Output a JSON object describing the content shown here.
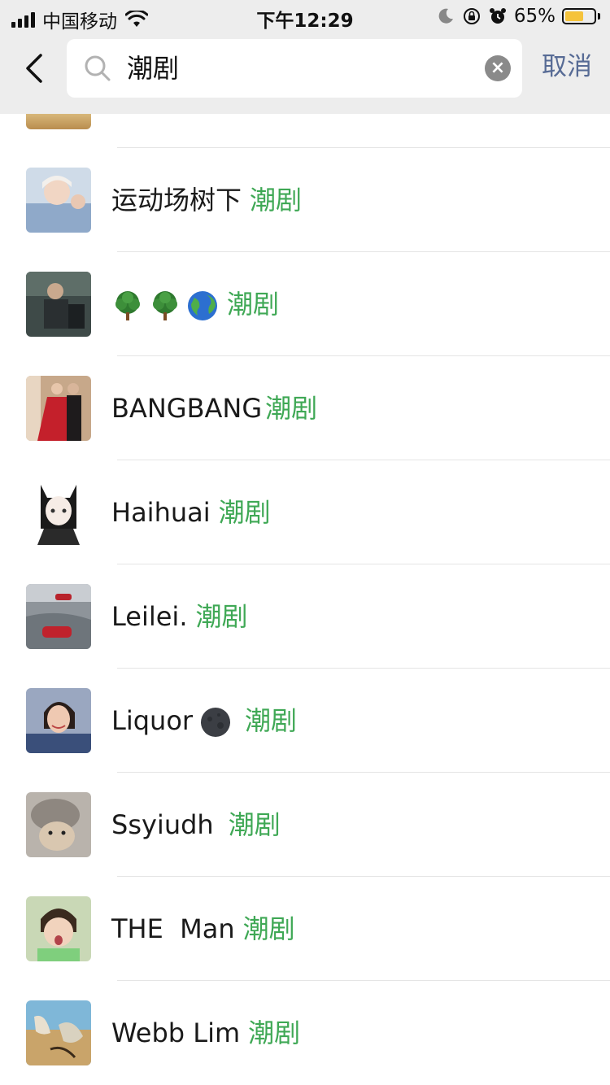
{
  "status_bar": {
    "carrier": "中国移动",
    "time": "下午12:29",
    "battery_pct": "65%",
    "battery_level": 0.65
  },
  "search": {
    "back_icon": "chevron-left-icon",
    "query": "潮剧",
    "cancel_label": "取消"
  },
  "colors": {
    "accent_green": "#3fa855",
    "link_blue": "#576b95",
    "header_bg": "#ededed"
  },
  "results": [
    {
      "name": "运动场树下",
      "match": "潮剧"
    },
    {
      "name": "",
      "match": "潮剧",
      "emojis": [
        "tree-icon",
        "tree-icon",
        "globe-icon"
      ]
    },
    {
      "name": "BANGBANG",
      "match": "潮剧"
    },
    {
      "name": "Haihuai",
      "match": "潮剧"
    },
    {
      "name": "Leilei.",
      "match": "潮剧"
    },
    {
      "name": "Liquor",
      "match": "潮剧",
      "emojis": [
        "new-moon-icon"
      ]
    },
    {
      "name": "Ssyiudh",
      "match": "潮剧"
    },
    {
      "name": "THE  Man",
      "match": "潮剧"
    },
    {
      "name": "Webb Lim",
      "match": "潮剧"
    }
  ]
}
